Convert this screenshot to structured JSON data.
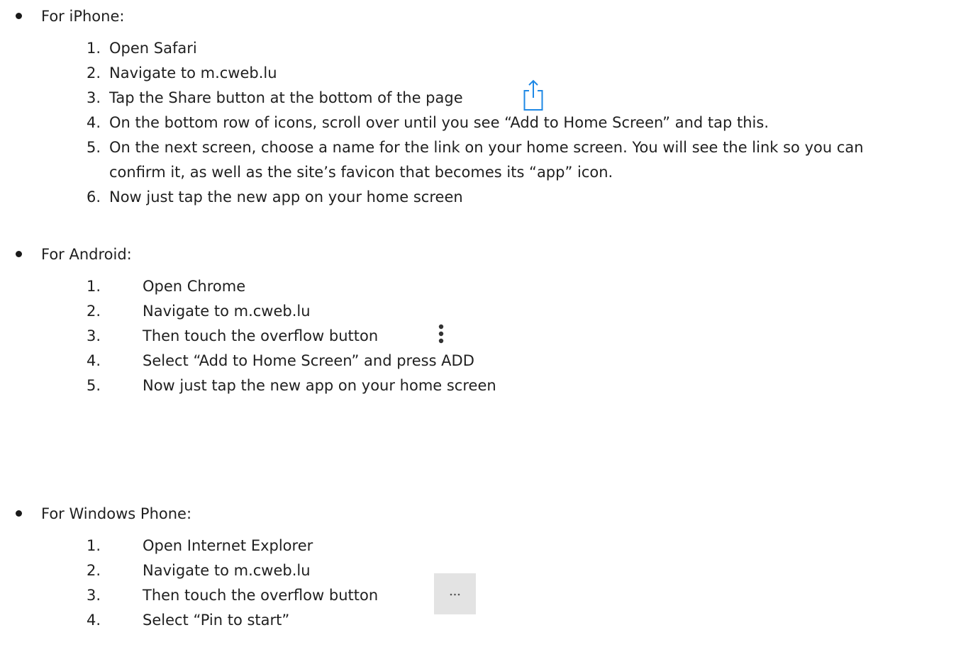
{
  "iphone": {
    "heading": "For iPhone:",
    "steps": [
      {
        "num": "1.",
        "text": "Open Safari"
      },
      {
        "num": "2.",
        "text": "Navigate to m.cweb.lu"
      },
      {
        "num": "3.",
        "text": "Tap the Share button at the bottom of the page"
      },
      {
        "num": "4.",
        "text": "On the bottom row of icons, scroll over until you see “Add to Home Screen” and tap this."
      },
      {
        "num": "5.",
        "text": "On the next screen, choose a name for the link on your home screen. You will see the link so you can",
        "continuation": "confirm it, as well as the site’s favicon that becomes its “app” icon."
      },
      {
        "num": "6.",
        "text": "Now just tap the new app on your home screen"
      }
    ],
    "step3_icon": "share-icon"
  },
  "android": {
    "heading": "For Android:",
    "steps": [
      {
        "num": "1.",
        "text": "Open Chrome"
      },
      {
        "num": "2.",
        "text": "Navigate to m.cweb.lu"
      },
      {
        "num": "3.",
        "text": "Then touch the overflow button"
      },
      {
        "num": "4.",
        "text": "Select “Add to Home Screen” and press ADD"
      },
      {
        "num": "5.",
        "text": "Now just tap the new app on your home screen"
      }
    ],
    "step3_icon": "vertical-dots-icon"
  },
  "windows": {
    "heading": "For Windows Phone:",
    "steps": [
      {
        "num": "1.",
        "text": "Open Internet Explorer"
      },
      {
        "num": "2.",
        "text": "Navigate to m.cweb.lu"
      },
      {
        "num": "3.",
        "text": "Then touch the overflow button"
      },
      {
        "num": "4.",
        "text": "Select “Pin to start”"
      }
    ],
    "step3_icon": "horizontal-dots-icon"
  },
  "colors": {
    "text": "#1f1f1f",
    "share_icon": "#1e88e5",
    "overflow_icon": "#333333",
    "windows_icon_bg": "#e3e3e3"
  }
}
